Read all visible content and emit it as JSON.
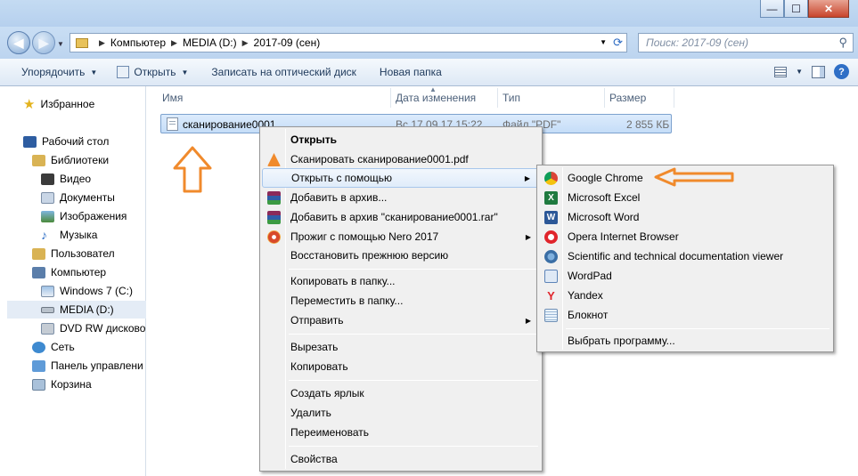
{
  "window": {
    "minimize": "—",
    "maximize": "☐",
    "close": "✕"
  },
  "address": {
    "crumbs": [
      "Компьютер",
      "MEDIA (D:)",
      "2017-09 (сен)"
    ]
  },
  "search": {
    "placeholder": "Поиск: 2017-09 (сен)"
  },
  "toolbar": {
    "organize": "Упорядочить",
    "open": "Открыть",
    "burn": "Записать на оптический диск",
    "new_folder": "Новая папка"
  },
  "nav": {
    "favorites": "Избранное",
    "desktop": "Рабочий стол",
    "libraries": "Библиотеки",
    "video": "Видео",
    "documents": "Документы",
    "images": "Изображения",
    "music": "Музыка",
    "user": "Пользовател",
    "computer": "Компьютер",
    "drive_c": "Windows 7 (C:)",
    "drive_d": "MEDIA (D:)",
    "dvd": "DVD RW дисково",
    "network": "Сеть",
    "control_panel": "Панель управлени",
    "recycle": "Корзина"
  },
  "columns": {
    "name": "Имя",
    "date": "Дата изменения",
    "type": "Тип",
    "size": "Размер"
  },
  "file": {
    "name": "сканирование0001",
    "date": "Вс 17.09.17 15:22",
    "type": "Файл \"PDF\"",
    "size": "2 855 КБ"
  },
  "context_menu": {
    "open": "Открыть",
    "scan": "Сканировать сканирование0001.pdf",
    "open_with": "Открыть с помощью",
    "add_archive": "Добавить в архив...",
    "add_rar": "Добавить в архив \"сканирование0001.rar\"",
    "nero": "Прожиг с помощью Nero 2017",
    "restore": "Восстановить прежнюю версию",
    "copy_to": "Копировать в папку...",
    "move_to": "Переместить в папку...",
    "send_to": "Отправить",
    "cut": "Вырезать",
    "copy": "Копировать",
    "shortcut": "Создать ярлык",
    "delete": "Удалить",
    "rename": "Переименовать",
    "properties": "Свойства"
  },
  "open_with_menu": {
    "chrome": "Google Chrome",
    "excel": "Microsoft Excel",
    "word": "Microsoft Word",
    "opera": "Opera Internet Browser",
    "scidoc": "Scientific and technical documentation viewer",
    "wordpad": "WordPad",
    "yandex": "Yandex",
    "notepad": "Блокнот",
    "choose": "Выбрать программу..."
  },
  "colors": {
    "accent": "#f08a2c",
    "selection": "#cfe3fb"
  }
}
